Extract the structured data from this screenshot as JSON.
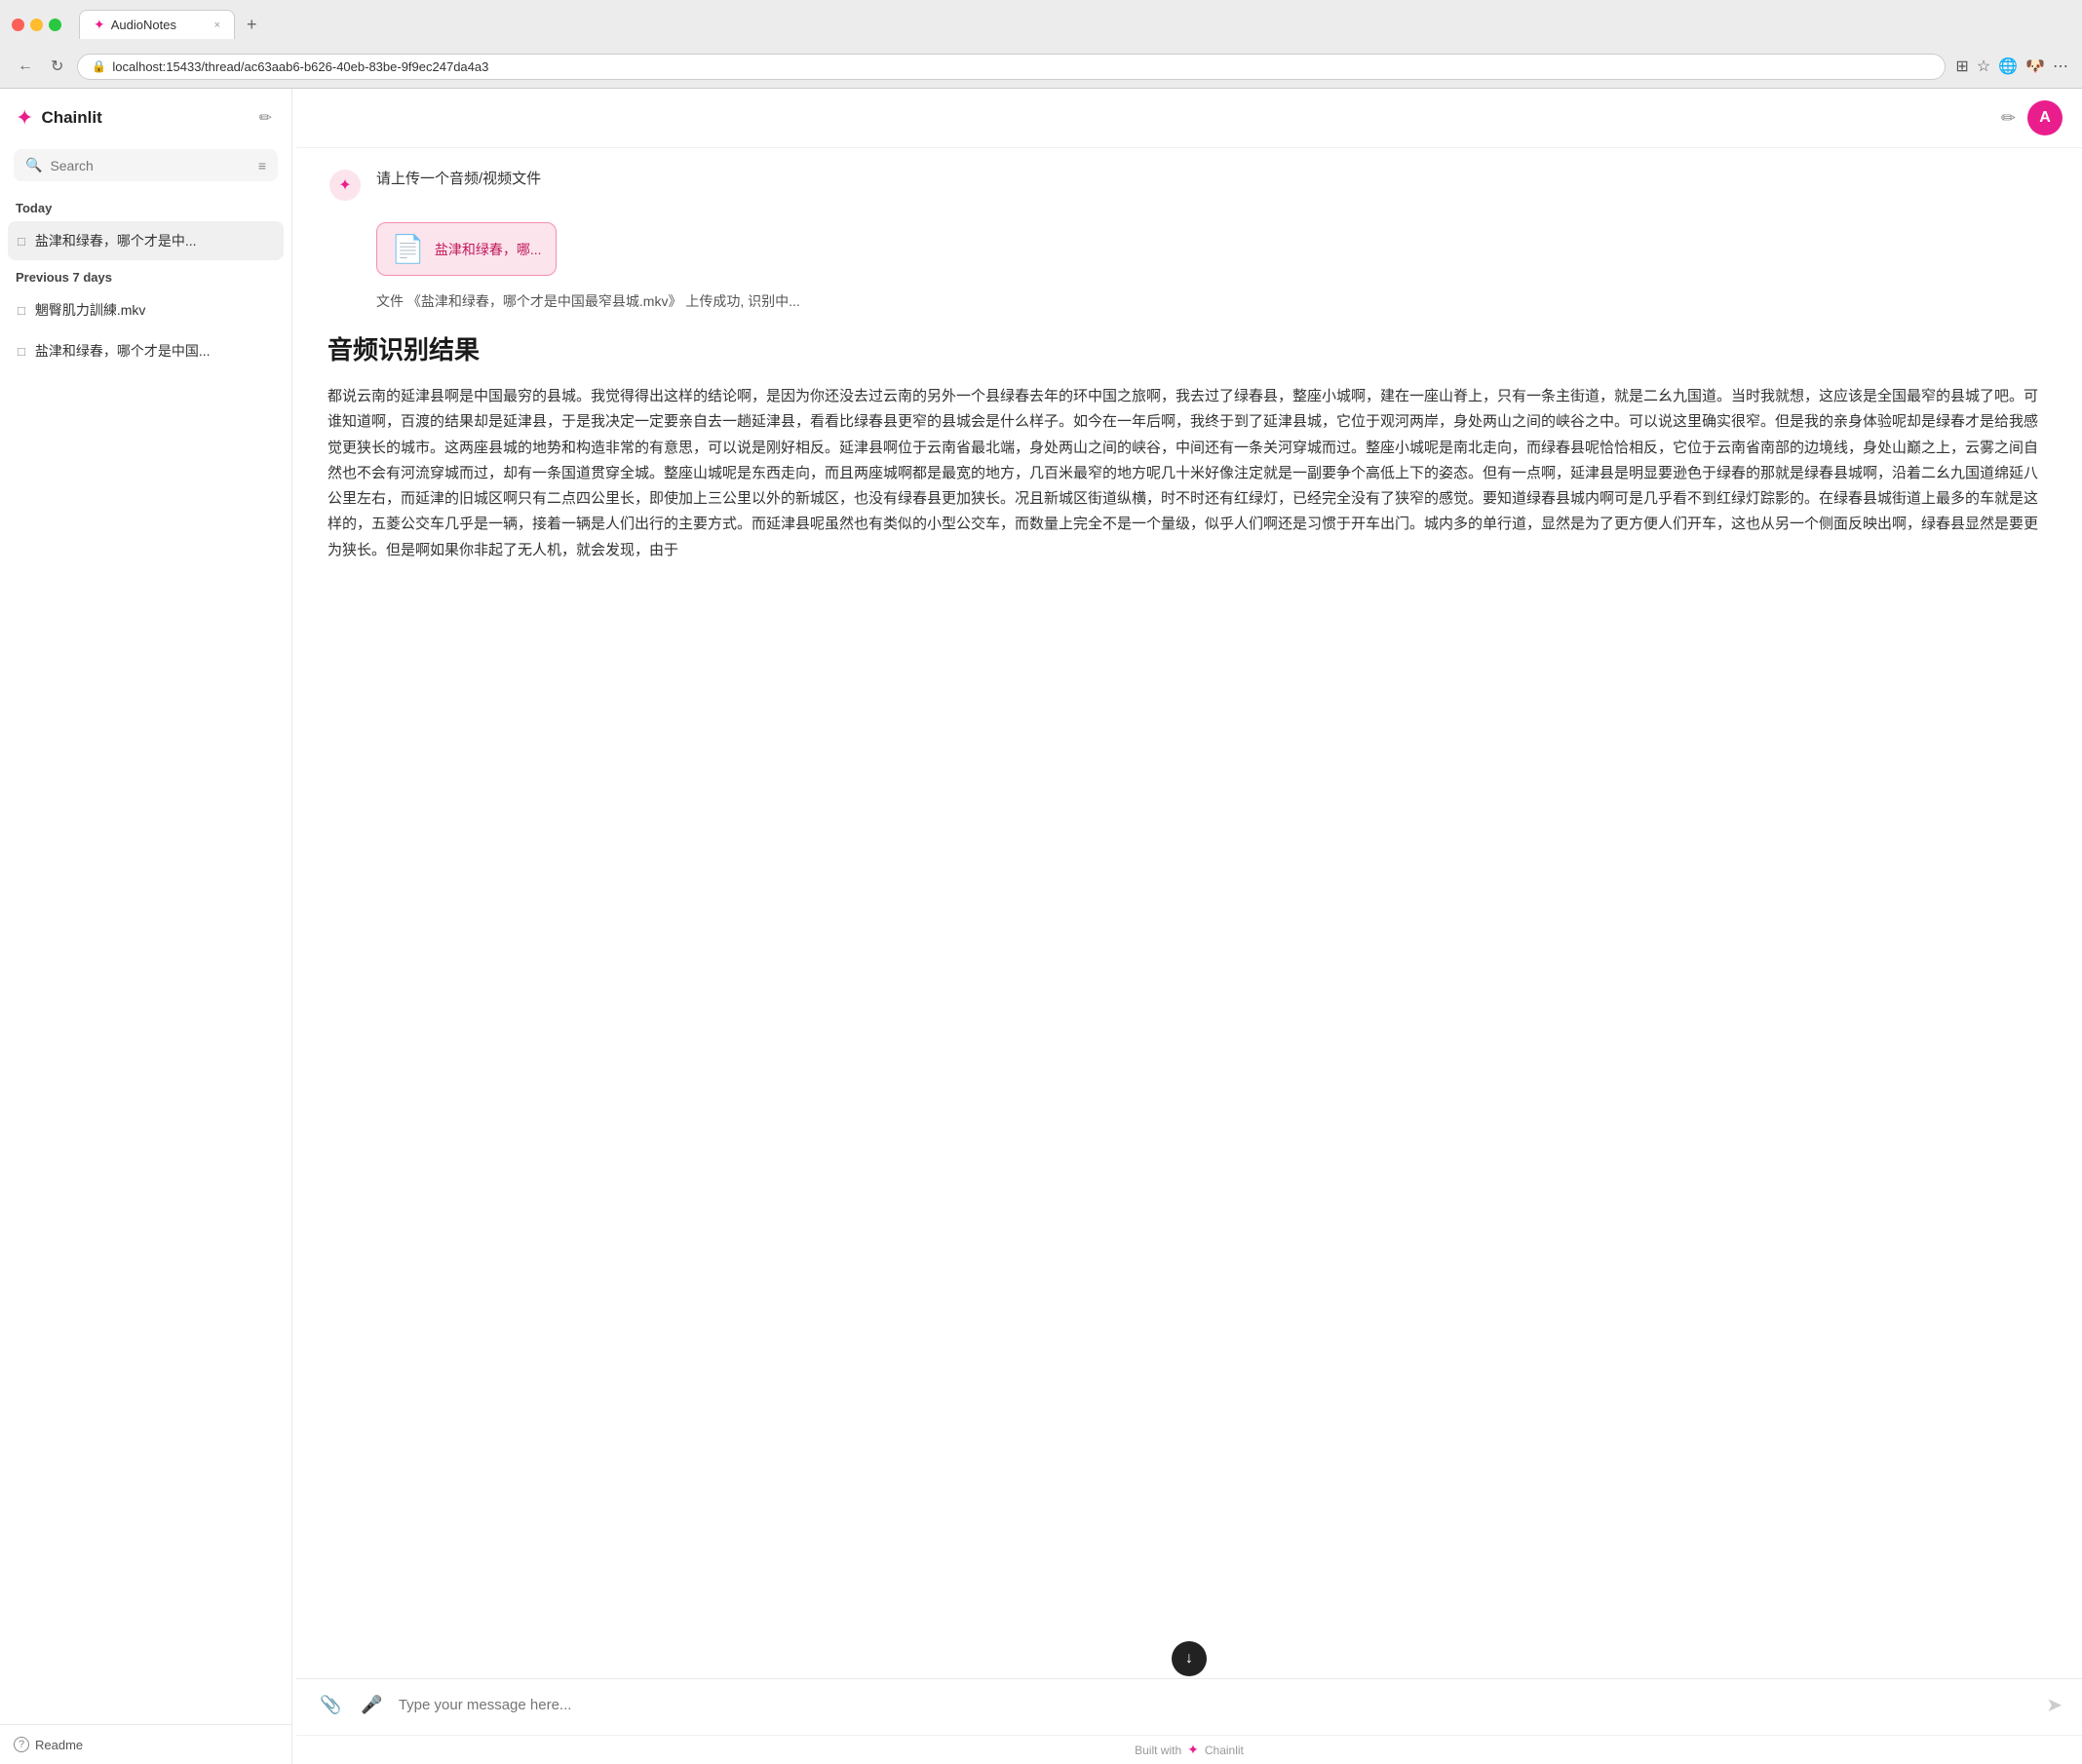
{
  "browser": {
    "tab_title": "AudioNotes",
    "url": "localhost:15433/thread/ac63aab6-b626-40eb-83be-9f9ec247da4a3",
    "tab_close": "×",
    "tab_new": "+"
  },
  "sidebar": {
    "logo_text": "Chainlit",
    "search_placeholder": "Search",
    "today_label": "Today",
    "prev_days_label": "Previous 7 days",
    "today_items": [
      {
        "text": "盐津和绿春，哪个才是中..."
      }
    ],
    "prev_items": [
      {
        "text": "魍臀肌力訓練.mkv"
      },
      {
        "text": "盐津和绿春，哪个才是中国..."
      }
    ],
    "readme_label": "Readme"
  },
  "main": {
    "prompt_text": "请上传一个音频/视频文件",
    "file_name": "盐津和绿春，哪...",
    "file_name_full": "盐津和绿春，哪个才是中国最窄县城.mkv",
    "status_text": "文件 《盐津和绿春，哪个才是中国最窄县城.mkv》 上传成功, 识别中...",
    "result_title": "音频识别结果",
    "result_body": "都说云南的延津县啊是中国最穷的县城。我觉得得出这样的结论啊，是因为你还没去过云南的另外一个县绿春去年的环中国之旅啊，我去过了绿春县，整座小城啊，建在一座山脊上，只有一条主街道，就是二幺九国道。当时我就想，这应该是全国最窄的县城了吧。可谁知道啊，百渡的结果却是延津县，于是我决定一定要亲自去一趟延津县，看看比绿春县更窄的县城会是什么样子。如今在一年后啊，我终于到了延津县城，它位于观河两岸，身处两山之间的峡谷之中。可以说这里确实很窄。但是我的亲身体验呢却是绿春才是给我感觉更狭长的城市。这两座县城的地势和构造非常的有意思，可以说是刚好相反。延津县啊位于云南省最北端，身处两山之间的峡谷，中间还有一条关河穿城而过。整座小城呢是南北走向，而绿春县呢恰恰相反，它位于云南省南部的边境线，身处山巅之上，云雾之间自然也不会有河流穿城而过，却有一条国道贯穿全城。整座山城呢是东西走向，而且两座城啊都是最宽的地方，几百米最窄的地方呢几十米好像注定就是一副要争个高低上下的姿态。但有一点啊，延津县是明显要逊色于绿春的那就是绿春县城啊，沿着二幺九国道绵延八公里左右，而延津的旧城区啊只有二点四公里长，即使加上三公里以外的新城区，也没有绿春县更加狭长。况且新城区街道纵横，时不时还有红绿灯，已经完全没有了狭窄的感觉。要知道绿春县城内啊可是几乎看不到红绿灯踪影的。在绿春县城街道上最多的车就是这样的，五菱公交车几乎是一辆，接着一辆是人们出行的主要方式。而延津县呢虽然也有类似的小型公交车，而数量上完全不是一个量级，似乎人们啊还是习惯于开车出门。城内多的单行道，显然是为了更方便人们开车，这也从另一个侧面反映出啊，绿春县显然是要更为狭长。但是啊如果你非起了无人机，就会发现，由于",
    "input_placeholder": "Type your message here...",
    "built_with": "Built with",
    "built_with_brand": "Chainlit"
  },
  "icons": {
    "logo": "✦",
    "search": "🔍",
    "filter": "≡",
    "chat_bubble": "□",
    "edit": "✏",
    "user_initial": "A",
    "attach": "📎",
    "mic": "🎤",
    "send": "➤",
    "scroll_down": "↓",
    "close": "×",
    "back": "←",
    "refresh": "↻",
    "readme": "?",
    "file": "📄",
    "trash": "🗑"
  },
  "colors": {
    "brand_pink": "#e91e8c",
    "user_avatar_bg": "#e91e8c"
  }
}
